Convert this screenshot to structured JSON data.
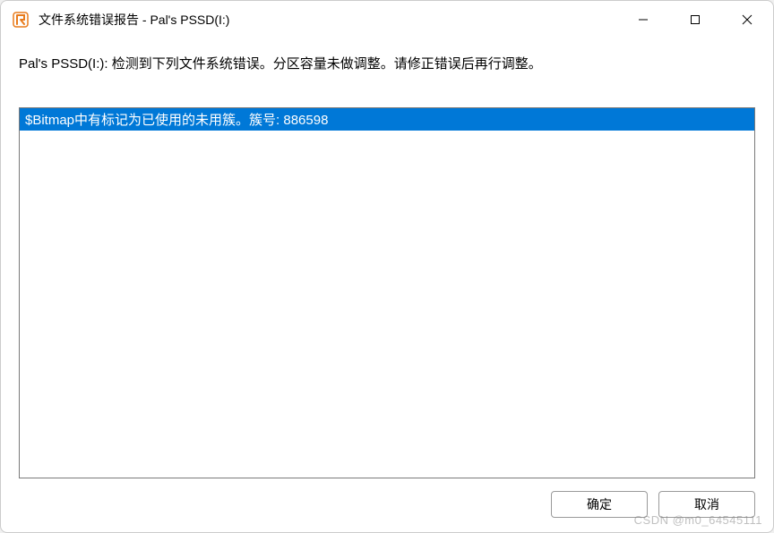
{
  "titlebar": {
    "title": "文件系统错误报告 - Pal's PSSD(I:)"
  },
  "content": {
    "message": "Pal's PSSD(I:): 检测到下列文件系统错误。分区容量未做调整。请修正错误后再行调整。"
  },
  "list": {
    "items": [
      {
        "text": "$Bitmap中有标记为已使用的未用簇。簇号: 886598",
        "selected": true
      }
    ]
  },
  "buttons": {
    "ok_label": "确定",
    "cancel_label": "取消"
  },
  "watermark": "CSDN @m0_64545111"
}
